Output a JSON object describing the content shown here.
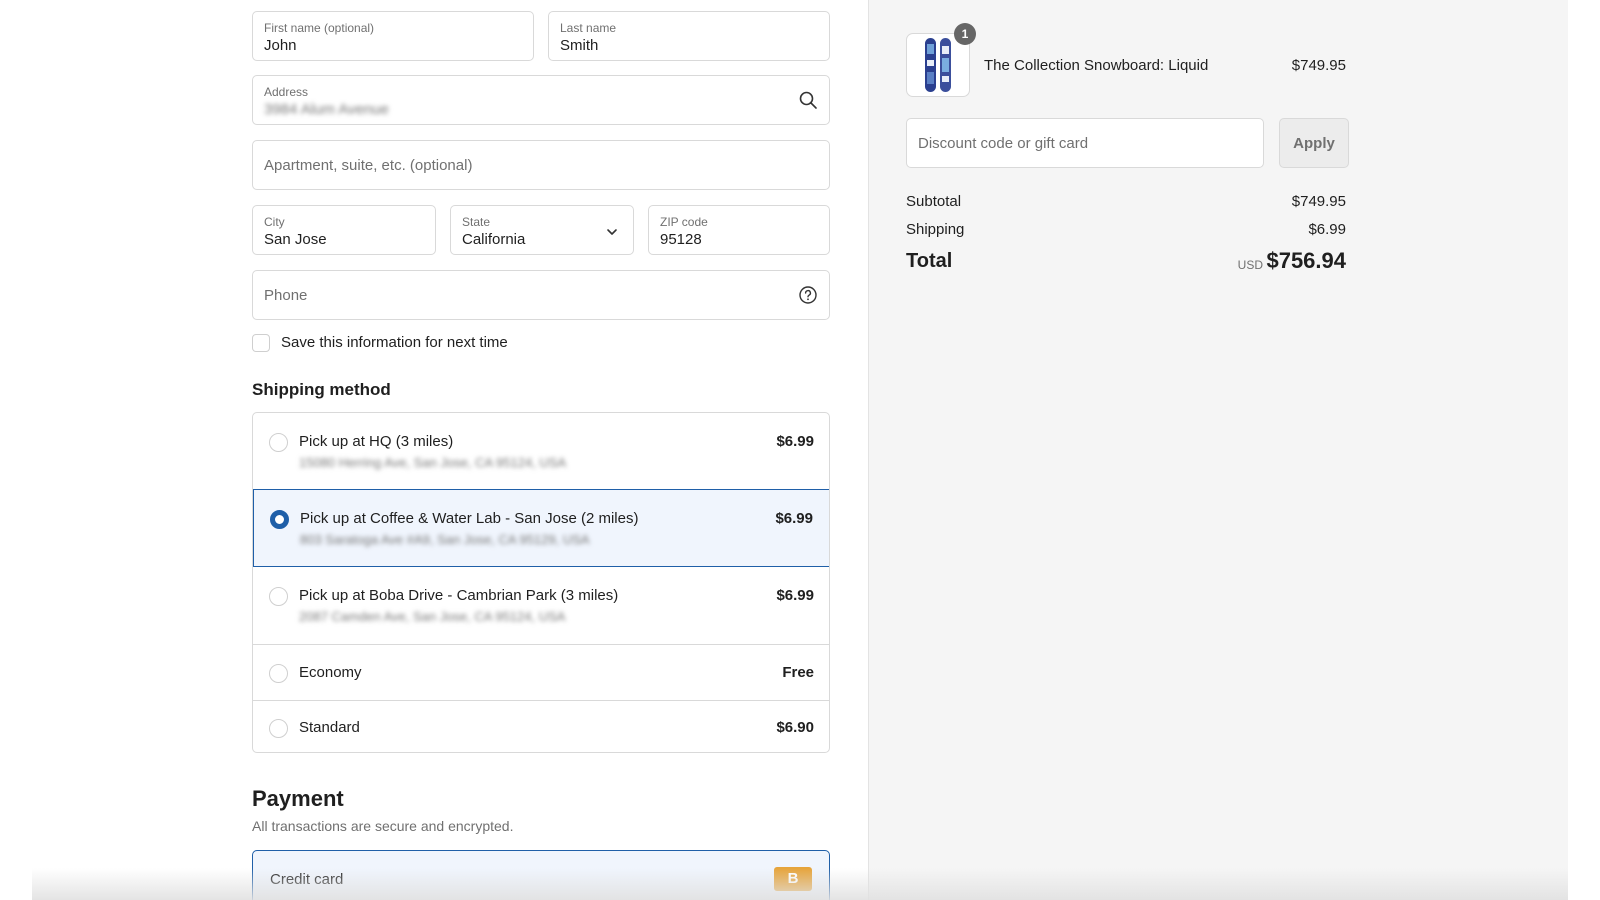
{
  "contact": {
    "first_name_label": "First name (optional)",
    "first_name_value": "John",
    "last_name_label": "Last name",
    "last_name_value": "Smith",
    "address_label": "Address",
    "address_value": "3984 Alum Avenue",
    "apartment_placeholder": "Apartment, suite, etc. (optional)",
    "city_label": "City",
    "city_value": "San Jose",
    "state_label": "State",
    "state_value": "California",
    "zip_label": "ZIP code",
    "zip_value": "95128",
    "phone_placeholder": "Phone",
    "save_info_label": "Save this information for next time",
    "save_info_checked": false
  },
  "shipping": {
    "title": "Shipping method",
    "options": [
      {
        "title": "Pick up at HQ (3 miles)",
        "address": "15080 Herring Ave, San Jose, CA 95124, USA",
        "price": "$6.99",
        "selected": false
      },
      {
        "title": "Pick up at Coffee & Water Lab - San Jose (2 miles)",
        "address": "803 Saratoga Ave #A9, San Jose, CA 95129, USA",
        "price": "$6.99",
        "selected": true
      },
      {
        "title": "Pick up at Boba Drive - Cambrian Park (3 miles)",
        "address": "2087 Camden Ave, San Jose, CA 95124, USA",
        "price": "$6.99",
        "selected": false
      },
      {
        "title": "Economy",
        "address": "",
        "price": "Free",
        "selected": false
      },
      {
        "title": "Standard",
        "address": "",
        "price": "$6.90",
        "selected": false
      }
    ]
  },
  "payment": {
    "title": "Payment",
    "subtitle": "All transactions are secure and encrypted.",
    "method_label": "Credit card",
    "badge": "B",
    "badge_color": "#e6a43b"
  },
  "summary": {
    "product_name": "The Collection Snowboard: Liquid",
    "product_price": "$749.95",
    "quantity": "1",
    "discount_placeholder": "Discount code or gift card",
    "apply_label": "Apply",
    "subtotal_label": "Subtotal",
    "subtotal_value": "$749.95",
    "shipping_label": "Shipping",
    "shipping_value": "$6.99",
    "total_label": "Total",
    "currency": "USD",
    "total_value": "$756.94"
  },
  "colors": {
    "accent": "#1f5fa8",
    "selected_bg": "#f0f5fd",
    "sidebar_bg": "#f5f5f5"
  },
  "icons": {
    "address": "search-icon",
    "state": "chevron-down-icon",
    "phone": "help-circle-icon"
  }
}
